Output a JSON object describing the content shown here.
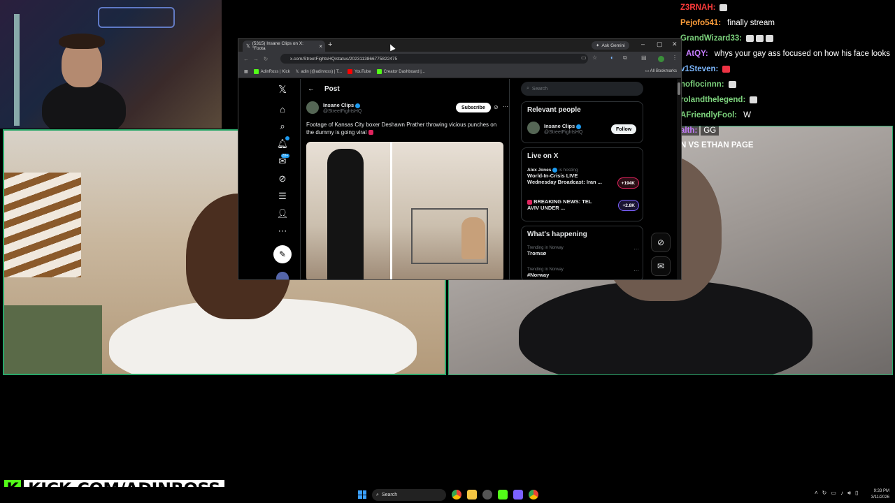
{
  "browser": {
    "tab_title": "(5315) Insane Clips on X: \"Foota",
    "gemini_label": "Ask Gemini",
    "url": "x.com/StreetFightsHQ/status/2023113866775822475",
    "bookmarks": [
      "AdinRoss | Kick",
      "adin (@adinross) | T...",
      "YouTube",
      "Creator Dashboard |..."
    ],
    "all_bookmarks": "All Bookmarks"
  },
  "x": {
    "post_header": "Post",
    "author_name": "Insane Clips",
    "author_handle": "@StreetFightsHQ",
    "subscribe": "Subscribe",
    "post_text": "Footage of Kansas City boxer Deshawn Prather throwing vicious punches on the dummy is going viral",
    "search_placeholder": "Search",
    "nav_badge_notifications": "",
    "nav_badge_messages": "20+",
    "relevant_title": "Relevant people",
    "rp_name": "Insane Clips",
    "rp_handle": "@StreetFightsHQ",
    "follow": "Follow",
    "live_title": "Live on X",
    "live": [
      {
        "host": "Alex Jones",
        "host_suffix": "is hosting",
        "title": "World-In-Crisis LIVE Wednesday Broadcast: Iran ...",
        "count": "+194K"
      },
      {
        "host": "",
        "host_suffix": "",
        "title": "BREAKING NEWS: TEL AVIV UNDER ...",
        "count": "+2.8K"
      }
    ],
    "happening_title": "What's happening",
    "trends": [
      {
        "meta": "Trending in Norway",
        "name": "Tromsø"
      },
      {
        "meta": "Trending in Norway",
        "name": "#Norway"
      }
    ]
  },
  "chat": [
    {
      "user": "Z3RNAH:",
      "color": "#ff3b3b",
      "msg": ""
    },
    {
      "user": "Pejofo541:",
      "color": "#ff9f3b",
      "msg": "finally stream"
    },
    {
      "user": "GrandWizard33:",
      "color": "#7dd37d",
      "msg": ""
    },
    {
      "user": "AtQY:",
      "color": "#c77dff",
      "msg": "whys your gay ass focused on how his face looks"
    },
    {
      "user": "v1Steven:",
      "color": "#7db8ff",
      "msg": ""
    },
    {
      "user": "noflocinnn:",
      "color": "#7dd37d",
      "msg": ""
    },
    {
      "user": "rolandthelegend:",
      "color": "#7dd37d",
      "msg": ""
    },
    {
      "user": "AFriendlyFool:",
      "color": "#7dd37d",
      "msg": "W"
    },
    {
      "user": "alth:",
      "color": "#c77dff",
      "msg": "GG"
    },
    {
      "user": "N VS ETHAN PAGE",
      "color": "#ffffff",
      "msg": ""
    }
  ],
  "kick": {
    "logo": "K",
    "text": "KICK.COM/ADINROSS"
  },
  "taskbar": {
    "search": "Search",
    "time": "9:33 PM",
    "date": "3/11/2026"
  }
}
